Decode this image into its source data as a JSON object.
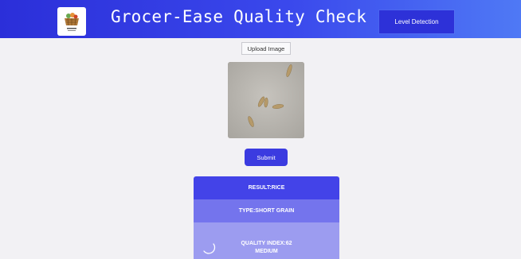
{
  "header": {
    "title": "Grocer-Ease Quality Check",
    "nav_button": "Level Detection",
    "logo_icon": "grocery-basket-logo"
  },
  "upload": {
    "label": "Upload Image"
  },
  "preview": {
    "icon": "rice-grains-image"
  },
  "submit": {
    "label": "Submit"
  },
  "results": {
    "result": "RESULT:RICE",
    "type": "TYPE:SHORT GRAIN",
    "quality_index": "QUALITY INDEX:62",
    "quality_level": "MEDIUM"
  },
  "colors": {
    "header_start": "#2b2fd9",
    "header_end": "#4f79f5",
    "accent": "#3b3be0",
    "result_card": "#4343e8",
    "type_card": "#7474ed",
    "quality_card": "#9c9cf0"
  }
}
